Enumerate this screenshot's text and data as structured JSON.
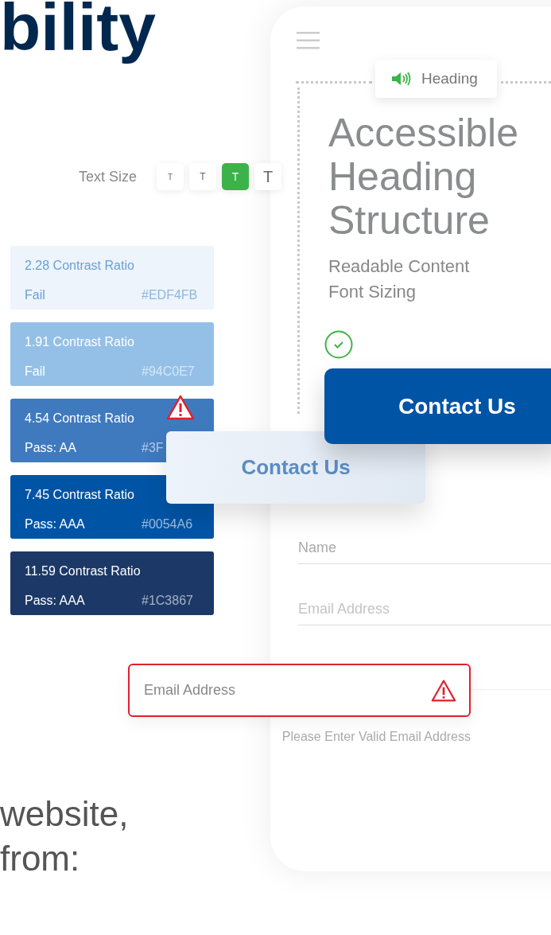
{
  "page_heading": "bility",
  "phone": {
    "tooltip": {
      "label": "Heading"
    },
    "title": [
      "Accessible",
      "Heading",
      "Structure"
    ],
    "subtitles": [
      "Readable Content",
      "Font Sizing"
    ],
    "check": {
      "checked": true
    },
    "primary_button": "Contact Us",
    "form": {
      "fields": [
        {
          "placeholder": "Name"
        },
        {
          "placeholder": "Email Address"
        }
      ]
    }
  },
  "text_size": {
    "label": "Text Size",
    "options": [
      {
        "label": "T",
        "selected": false
      },
      {
        "label": "T",
        "selected": false
      },
      {
        "label": "T",
        "selected": true
      },
      {
        "label": "T",
        "selected": false
      }
    ]
  },
  "contrast_cards": [
    {
      "ratio": "2.28 Contrast Ratio",
      "result": "Fail",
      "hex": "#EDF4FB",
      "color": "#edf4fb",
      "kind": "pale"
    },
    {
      "ratio": "1.91 Contrast Ratio",
      "result": "Fail",
      "hex": "#94C0E7",
      "color": "#94c0e7",
      "kind": "solid"
    },
    {
      "ratio": "4.54 Contrast Ratio",
      "result": "Pass: AA",
      "hex": "#3F",
      "color": "#3f7abf",
      "kind": "solid"
    },
    {
      "ratio": "7.45 Contrast Ratio",
      "result": "Pass: AAA",
      "hex": "#0054A6",
      "color": "#0054a6",
      "kind": "solid"
    },
    {
      "ratio": "11.59 Contrast Ratio",
      "result": "Pass: AAA",
      "hex": "#1C3867",
      "color": "#1c3867",
      "kind": "solid"
    }
  ],
  "low_contrast_button": "Contact Us",
  "error_field": {
    "placeholder": "Email Address",
    "error": true,
    "message": "Please Enter Valid Email Address"
  },
  "body_text": [
    "website,",
    "from:"
  ]
}
